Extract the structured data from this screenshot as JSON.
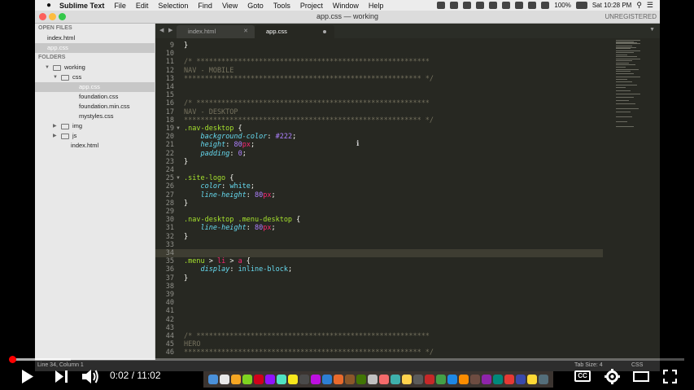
{
  "menubar": {
    "app_name": "Sublime Text",
    "items": [
      "File",
      "Edit",
      "Selection",
      "Find",
      "View",
      "Goto",
      "Tools",
      "Project",
      "Window",
      "Help"
    ],
    "battery": "100%",
    "clock": "Sat 10:28 PM"
  },
  "window": {
    "title": "app.css — working",
    "unregistered": "UNREGISTERED"
  },
  "sidebar": {
    "open_files_header": "OPEN FILES",
    "open_files": [
      "index.html",
      "app.css"
    ],
    "folders_header": "FOLDERS",
    "tree": [
      {
        "label": "working",
        "depth": 0,
        "type": "folder",
        "expanded": true
      },
      {
        "label": "css",
        "depth": 1,
        "type": "folder",
        "expanded": true
      },
      {
        "label": "app.css",
        "depth": 2,
        "type": "file",
        "selected": true
      },
      {
        "label": "foundation.css",
        "depth": 2,
        "type": "file"
      },
      {
        "label": "foundation.min.css",
        "depth": 2,
        "type": "file"
      },
      {
        "label": "mystyles.css",
        "depth": 2,
        "type": "file"
      },
      {
        "label": "img",
        "depth": 1,
        "type": "folder",
        "expanded": false
      },
      {
        "label": "js",
        "depth": 1,
        "type": "folder",
        "expanded": false
      },
      {
        "label": "index.html",
        "depth": 1,
        "type": "file"
      }
    ]
  },
  "tabs": [
    {
      "label": "index.html",
      "active": false
    },
    {
      "label": "app.css",
      "active": true
    }
  ],
  "editor": {
    "current_line": 34,
    "lines": [
      {
        "n": "9",
        "t": [
          [
            "}",
            ""
          ]
        ]
      },
      {
        "n": "10",
        "t": []
      },
      {
        "n": "11",
        "t": [
          [
            "/* ********************************************************",
            "c"
          ]
        ]
      },
      {
        "n": "12",
        "t": [
          [
            "NAV - MOBILE",
            "c"
          ]
        ]
      },
      {
        "n": "13",
        "t": [
          [
            "********************************************************* */",
            "c"
          ]
        ]
      },
      {
        "n": "14",
        "t": []
      },
      {
        "n": "15",
        "t": []
      },
      {
        "n": "16",
        "t": [
          [
            "/* ********************************************************",
            "c"
          ]
        ]
      },
      {
        "n": "17",
        "t": [
          [
            "NAV - DESKTOP",
            "c"
          ]
        ]
      },
      {
        "n": "18",
        "t": [
          [
            "********************************************************* */",
            "c"
          ]
        ]
      },
      {
        "n": "19",
        "fold": true,
        "t": [
          [
            ".nav-desktop",
            "s"
          ],
          [
            " {",
            ""
          ]
        ]
      },
      {
        "n": "20",
        "t": [
          [
            "    ",
            ""
          ],
          [
            "background-color",
            "p"
          ],
          [
            ": ",
            ""
          ],
          [
            "#222",
            "n"
          ],
          [
            ";",
            ""
          ]
        ]
      },
      {
        "n": "21",
        "t": [
          [
            "    ",
            ""
          ],
          [
            "height",
            "p"
          ],
          [
            ": ",
            ""
          ],
          [
            "80",
            "n"
          ],
          [
            "px",
            "u"
          ],
          [
            ";",
            ""
          ]
        ]
      },
      {
        "n": "22",
        "t": [
          [
            "    ",
            ""
          ],
          [
            "padding",
            "p"
          ],
          [
            ": ",
            ""
          ],
          [
            "0",
            "n"
          ],
          [
            ";",
            ""
          ]
        ]
      },
      {
        "n": "23",
        "t": [
          [
            "}",
            ""
          ]
        ]
      },
      {
        "n": "24",
        "t": []
      },
      {
        "n": "25",
        "fold": true,
        "t": [
          [
            ".site-logo",
            "s"
          ],
          [
            " {",
            ""
          ]
        ]
      },
      {
        "n": "26",
        "t": [
          [
            "    ",
            ""
          ],
          [
            "color",
            "p"
          ],
          [
            ": ",
            ""
          ],
          [
            "white",
            "v"
          ],
          [
            ";",
            ""
          ]
        ]
      },
      {
        "n": "27",
        "t": [
          [
            "    ",
            ""
          ],
          [
            "line-height",
            "p"
          ],
          [
            ": ",
            ""
          ],
          [
            "80",
            "n"
          ],
          [
            "px",
            "u"
          ],
          [
            ";",
            ""
          ]
        ]
      },
      {
        "n": "28",
        "t": [
          [
            "}",
            ""
          ]
        ]
      },
      {
        "n": "29",
        "t": []
      },
      {
        "n": "30",
        "t": [
          [
            ".nav-desktop .menu-desktop",
            "s"
          ],
          [
            " {",
            ""
          ]
        ]
      },
      {
        "n": "31",
        "t": [
          [
            "    ",
            ""
          ],
          [
            "line-height",
            "p"
          ],
          [
            ": ",
            ""
          ],
          [
            "80",
            "n"
          ],
          [
            "px",
            "u"
          ],
          [
            ";",
            ""
          ]
        ]
      },
      {
        "n": "32",
        "t": [
          [
            "}",
            ""
          ]
        ]
      },
      {
        "n": "33",
        "t": []
      },
      {
        "n": "34",
        "t": []
      },
      {
        "n": "35",
        "t": [
          [
            ".menu",
            "s"
          ],
          [
            " > ",
            ""
          ],
          [
            "li",
            "u"
          ],
          [
            " > ",
            ""
          ],
          [
            "a",
            "u"
          ],
          [
            " {",
            ""
          ]
        ]
      },
      {
        "n": "36",
        "t": [
          [
            "    ",
            ""
          ],
          [
            "display",
            "p"
          ],
          [
            ": ",
            ""
          ],
          [
            "inline-block",
            "v"
          ],
          [
            ";",
            ""
          ]
        ]
      },
      {
        "n": "37",
        "t": [
          [
            "}",
            ""
          ]
        ]
      },
      {
        "n": "38",
        "t": []
      },
      {
        "n": "39",
        "t": []
      },
      {
        "n": "40",
        "t": []
      },
      {
        "n": "41",
        "t": []
      },
      {
        "n": "42",
        "t": []
      },
      {
        "n": "43",
        "t": []
      },
      {
        "n": "44",
        "t": [
          [
            "/* ********************************************************",
            "c"
          ]
        ]
      },
      {
        "n": "45",
        "t": [
          [
            "HERO",
            "c"
          ]
        ]
      },
      {
        "n": "46",
        "t": [
          [
            "********************************************************* */",
            "c"
          ]
        ]
      }
    ]
  },
  "statusbar": {
    "position": "Line 34, Column 1",
    "tab_size": "Tab Size: 4",
    "syntax": "CSS"
  },
  "player": {
    "current_time": "0:02",
    "duration": "11:02",
    "time_display": "0:02 / 11:02",
    "played_fraction": 0.003,
    "buffered_fraction": 0.09,
    "accent": "#ff0000"
  }
}
